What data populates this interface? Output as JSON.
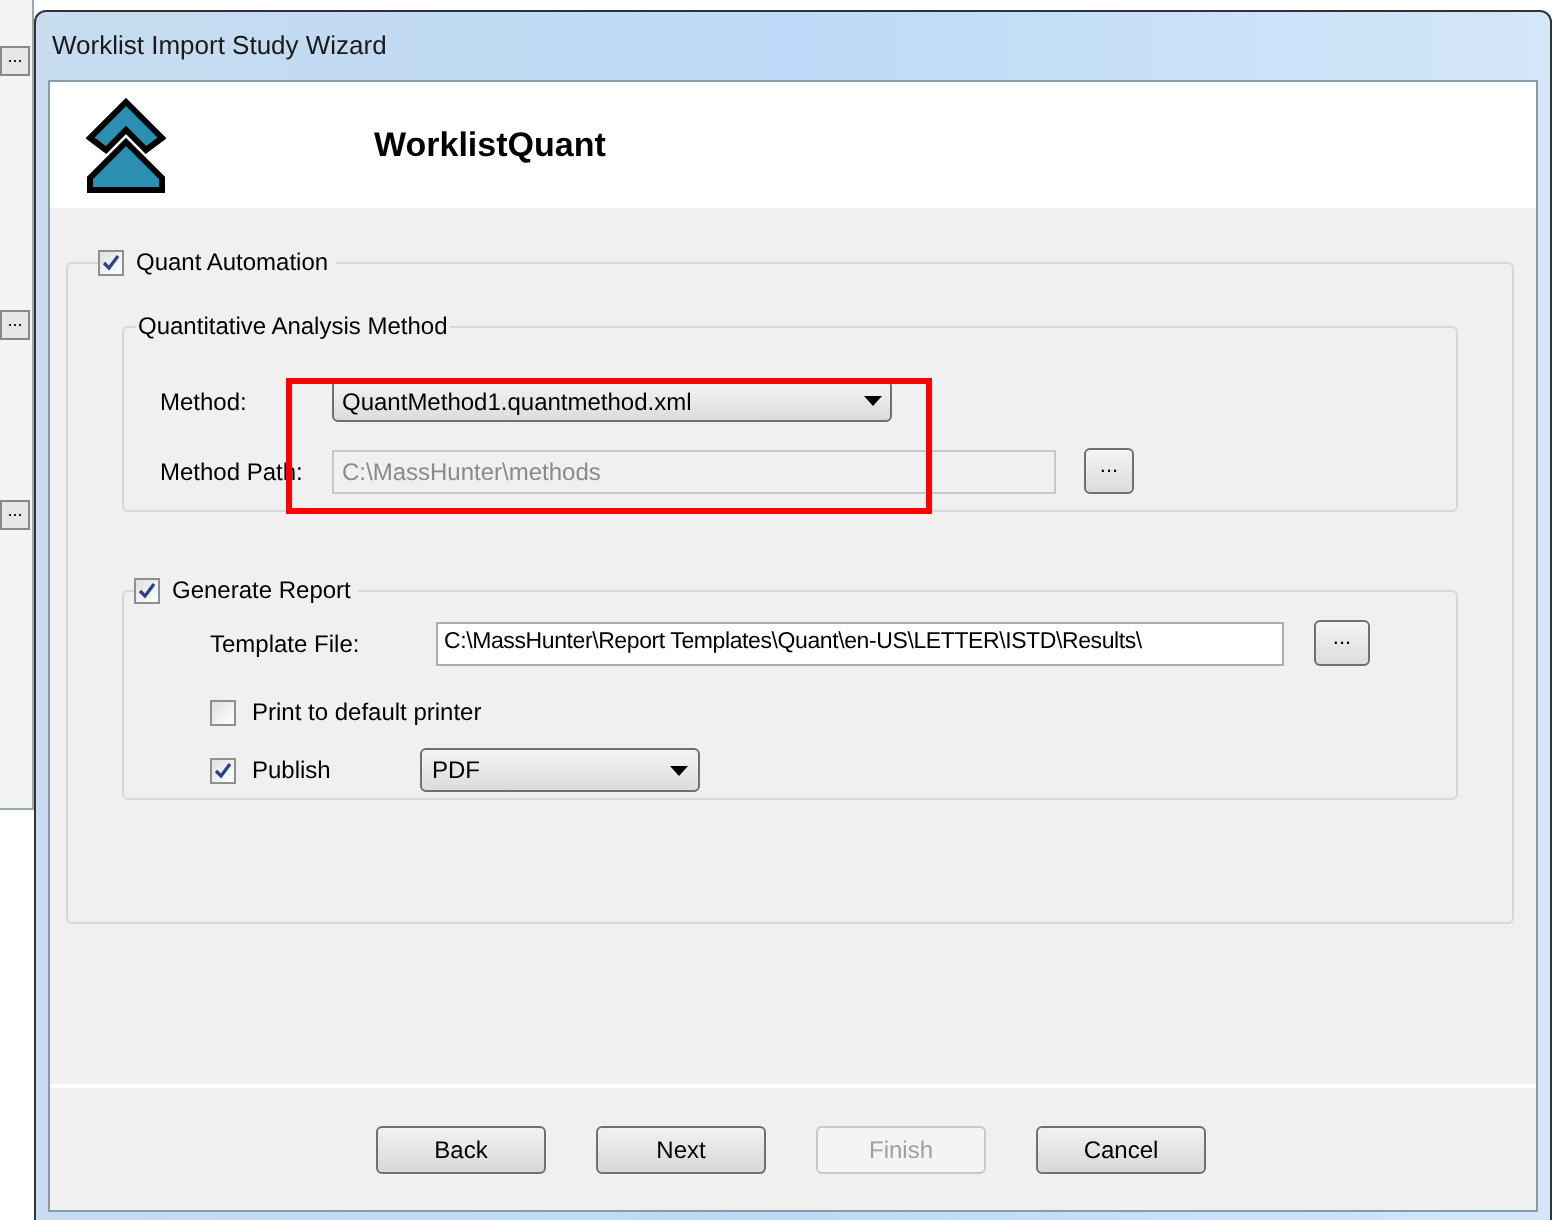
{
  "background_window": {
    "buttons": [
      "...",
      "...",
      "..."
    ]
  },
  "window": {
    "title": "Worklist Import Study Wizard"
  },
  "header": {
    "title": "WorklistQuant"
  },
  "quant_automation": {
    "label": "Quant Automation",
    "checked": true,
    "method_group": {
      "title": "Quantitative Analysis Method",
      "method": {
        "label": "Method:",
        "value": "QuantMethod1.quantmethod.xml"
      },
      "method_path": {
        "label": "Method Path:",
        "value": "C:\\MassHunter\\methods",
        "disabled": true,
        "browse": "..."
      }
    },
    "generate_report": {
      "label": "Generate Report",
      "checked": true,
      "template_file": {
        "label": "Template File:",
        "value": "C:\\MassHunter\\Report Templates\\Quant\\en-US\\LETTER\\ISTD\\Results\\",
        "browse": "..."
      },
      "print_default": {
        "label": "Print to default printer",
        "checked": false
      },
      "publish": {
        "label": "Publish",
        "checked": true,
        "format": "PDF"
      }
    }
  },
  "buttons": [
    {
      "label": "Back",
      "disabled": false
    },
    {
      "label": "Next",
      "disabled": false
    },
    {
      "label": "Finish",
      "disabled": true
    },
    {
      "label": "Cancel",
      "disabled": false
    }
  ]
}
